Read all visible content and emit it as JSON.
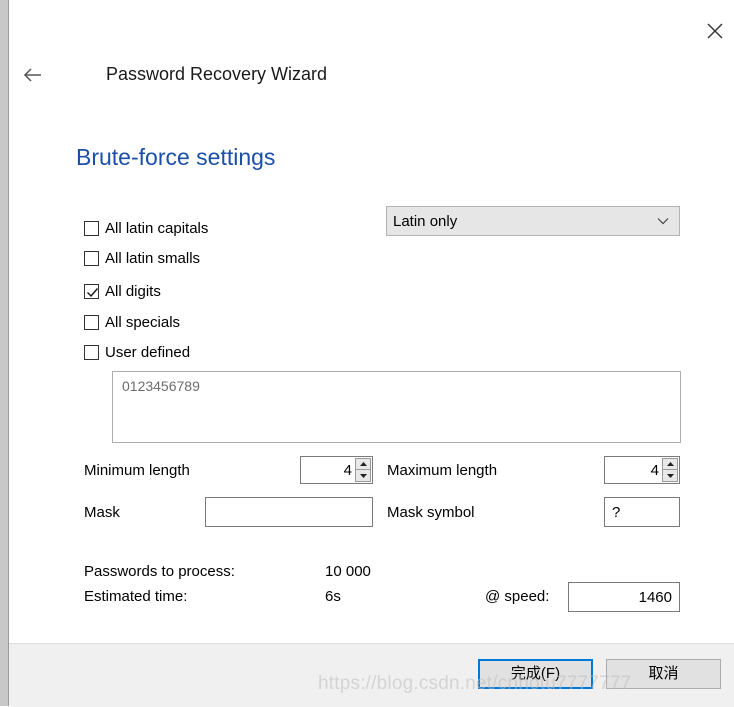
{
  "window": {
    "title": "Password Recovery Wizard",
    "close_icon": "close-icon",
    "back_icon": "back-arrow-icon"
  },
  "section": {
    "title": "Brute-force settings"
  },
  "charsets": {
    "items": [
      {
        "label": "All latin capitals",
        "checked": false
      },
      {
        "label": "All latin smalls",
        "checked": false
      },
      {
        "label": "All digits",
        "checked": true
      },
      {
        "label": "All specials",
        "checked": false
      },
      {
        "label": "User defined",
        "checked": false
      }
    ],
    "language_select": {
      "value": "Latin only"
    },
    "charset_preview": "0123456789"
  },
  "length": {
    "min_label": "Minimum length",
    "min_value": "4",
    "max_label": "Maximum length",
    "max_value": "4"
  },
  "mask": {
    "label": "Mask",
    "value": "",
    "symbol_label": "Mask symbol",
    "symbol_value": "?"
  },
  "stats": {
    "passwords_label": "Passwords to process:",
    "passwords_value": "10 000",
    "time_label": "Estimated time:",
    "time_value": "6s",
    "speed_label": "@ speed:",
    "speed_value": "1460"
  },
  "footer": {
    "finish_label": "完成(F)",
    "cancel_label": "取消"
  },
  "watermark": "https://blog.csdn.net/cnhotu7777777",
  "colors": {
    "section_title": "#1c4fa8",
    "primary_border": "#0078d7",
    "footer_bg": "#f0f0f0"
  }
}
